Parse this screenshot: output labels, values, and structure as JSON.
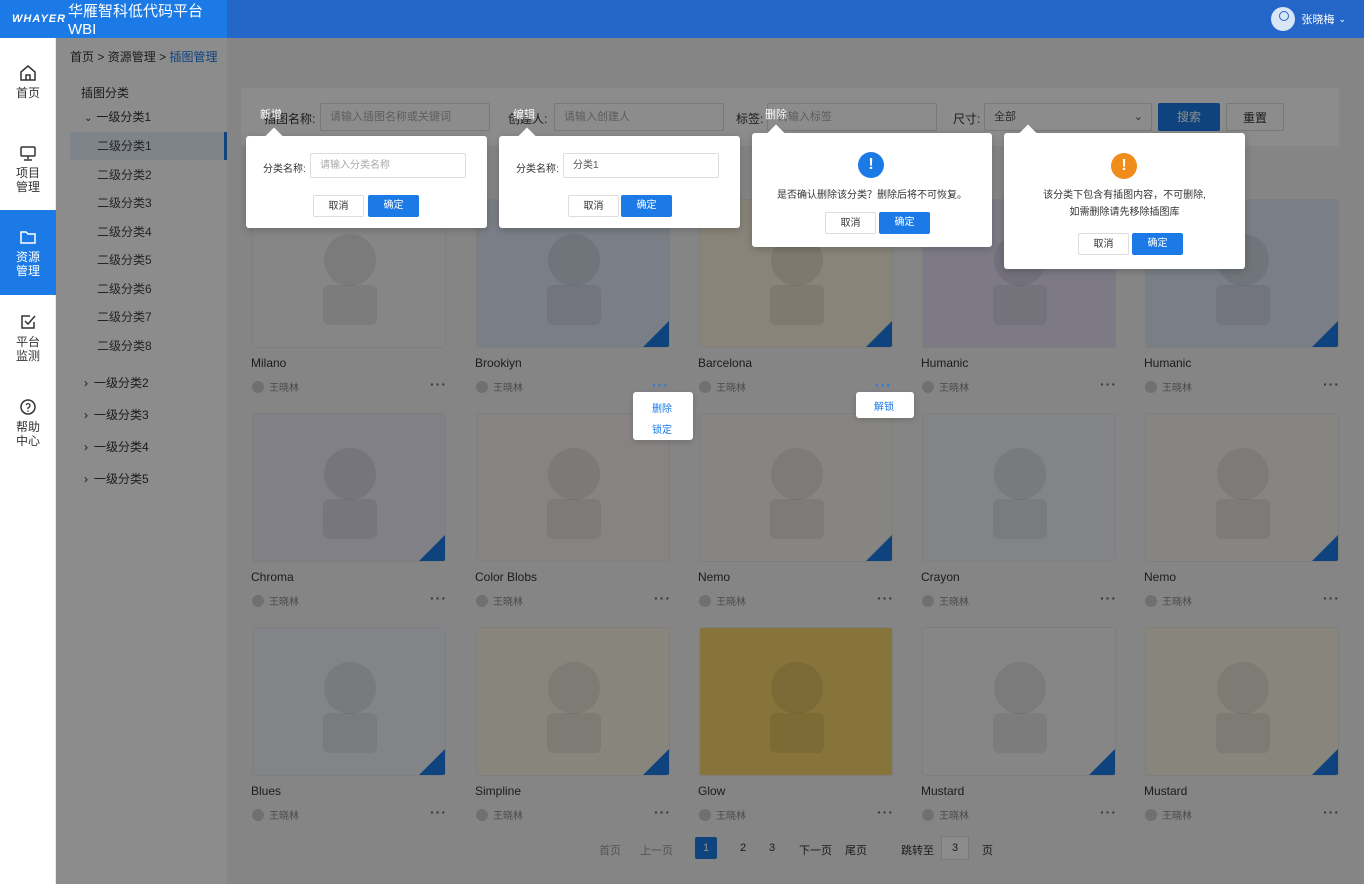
{
  "brand": {
    "logo": "WHAYER",
    "title": "华雁智科低代码平台WBI"
  },
  "user": {
    "name": "张晓梅"
  },
  "nav": {
    "home": "首页",
    "project": [
      "项目",
      "管理"
    ],
    "resource": [
      "资源",
      "管理"
    ],
    "monitor": [
      "平台",
      "监测"
    ],
    "help": [
      "帮助",
      "中心"
    ]
  },
  "breadcrumb": {
    "home": "首页",
    "sep": ">",
    "resource": "资源管理",
    "current": "插图管理"
  },
  "tree": {
    "title": "插图分类",
    "level1": [
      "一级分类1",
      "一级分类2",
      "一级分类3",
      "一级分类4",
      "一级分类5"
    ],
    "level2": [
      "二级分类1",
      "二级分类2",
      "二级分类3",
      "二级分类4",
      "二级分类5",
      "二级分类6",
      "二级分类7",
      "二级分类8"
    ]
  },
  "search": {
    "name_label": "插图名称:",
    "name_placeholder": "请输入插图名称或关键词",
    "creator_label": "创建人:",
    "creator_placeholder": "请输入创建人",
    "tag_label": "标签:",
    "tag_placeholder": "请输入标签",
    "size_label": "尺寸:",
    "size_value": "全部",
    "search_btn": "搜索",
    "reset_btn": "重置"
  },
  "popups": {
    "add": {
      "title": "新增",
      "label": "分类名称:",
      "placeholder": "请输入分类名称",
      "cancel": "取消",
      "ok": "确定"
    },
    "edit": {
      "title": "编辑",
      "label": "分类名称:",
      "value": "分类1",
      "cancel": "取消",
      "ok": "确定"
    },
    "delete": {
      "title": "删除",
      "message": "是否确认删除该分类？删除后将不可恢复。",
      "cancel": "取消",
      "ok": "确定"
    },
    "blocked": {
      "line1": "该分类下包含有插图内容，不可删除,",
      "line2": "如需删除请先移除插图库",
      "cancel": "取消",
      "ok": "确定"
    }
  },
  "context_menus": {
    "card2": [
      "删除",
      "锁定"
    ],
    "card3": [
      "解锁"
    ]
  },
  "author": "王晓林",
  "cards": [
    {
      "name": "Milano",
      "locked": false
    },
    {
      "name": "Brookiyn",
      "locked": true
    },
    {
      "name": "Barcelona",
      "locked": true
    },
    {
      "name": "Humanic",
      "locked": false
    },
    {
      "name": "Humanic",
      "locked": true
    },
    {
      "name": "Chroma",
      "locked": true
    },
    {
      "name": "Color Blobs",
      "locked": false
    },
    {
      "name": "Nemo",
      "locked": true
    },
    {
      "name": "Crayon",
      "locked": false
    },
    {
      "name": "Nemo",
      "locked": true
    },
    {
      "name": "Blues",
      "locked": true
    },
    {
      "name": "Simpline",
      "locked": true
    },
    {
      "name": "Glow",
      "locked": false
    },
    {
      "name": "Mustard",
      "locked": true
    },
    {
      "name": "Mustard",
      "locked": true
    }
  ],
  "pagination": {
    "first": "首页",
    "prev": "上一页",
    "pages": [
      "1",
      "2",
      "3"
    ],
    "current": "1",
    "next": "下一页",
    "last": "尾页",
    "jump_label": "跳转至",
    "jump_value": "3",
    "page_unit": "页"
  },
  "colors": {
    "primary": "#1b7ae6",
    "warning": "#f08c1a"
  }
}
